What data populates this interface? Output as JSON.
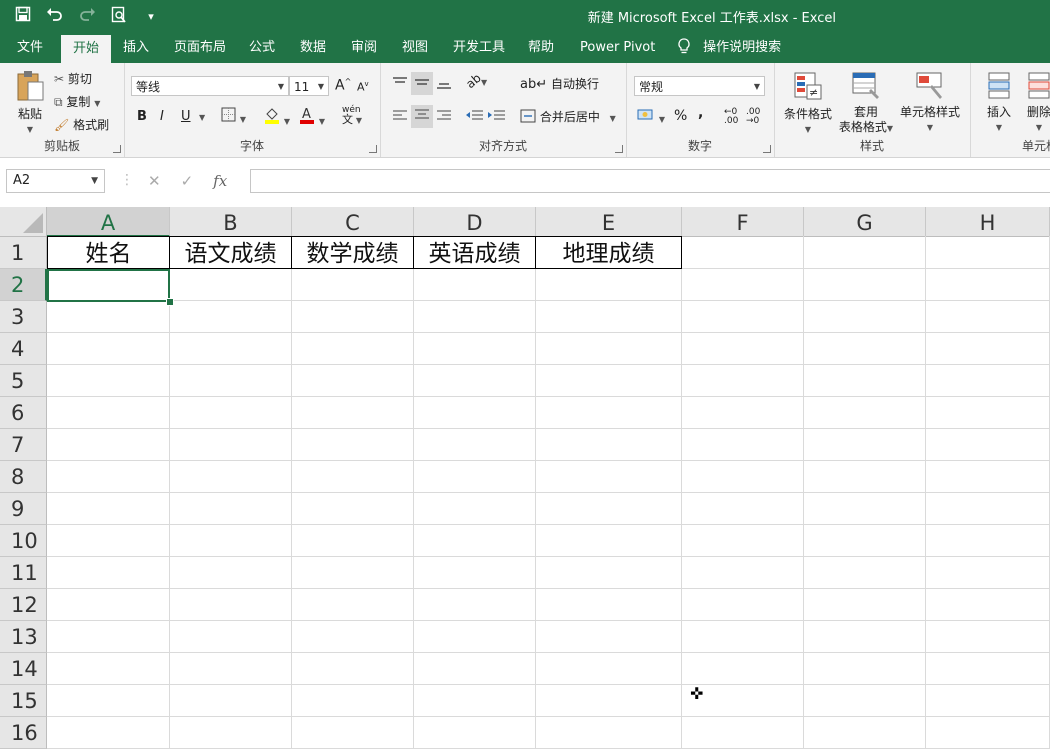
{
  "window": {
    "title": "新建 Microsoft Excel 工作表.xlsx  -  Excel"
  },
  "qat": {
    "save": "save-icon",
    "undo": "undo-icon",
    "redo": "redo-icon",
    "print_preview": "print-preview-icon",
    "customize": "▾"
  },
  "menu": {
    "tabs": [
      "文件",
      "开始",
      "插入",
      "页面布局",
      "公式",
      "数据",
      "审阅",
      "视图",
      "开发工具",
      "帮助",
      "Power Pivot"
    ],
    "active_tab": "开始",
    "tell_me": "操作说明搜索"
  },
  "ribbon": {
    "clipboard": {
      "label": "剪贴板",
      "paste": "粘贴",
      "cut": "剪切",
      "copy": "复制",
      "format_painter": "格式刷"
    },
    "font": {
      "label": "字体",
      "name": "等线",
      "size": "11",
      "bold": "B",
      "italic": "I",
      "underline": "U",
      "phonetic": "wén"
    },
    "alignment": {
      "label": "对齐方式",
      "wrap_text": "自动换行",
      "merge_center": "合并后居中"
    },
    "number": {
      "label": "数字",
      "format": "常规",
      "percent": "%",
      "comma": ","
    },
    "styles": {
      "label": "样式",
      "conditional": "条件格式",
      "table_fmt_1": "套用",
      "table_fmt_2": "表格格式",
      "cell_styles": "单元格样式"
    },
    "cells": {
      "label": "单元格",
      "insert": "插入",
      "delete": "删除"
    }
  },
  "formula_bar": {
    "name_box": "A2",
    "cancel": "✕",
    "enter": "✓",
    "fx": "fx",
    "formula": ""
  },
  "sheet": {
    "columns": [
      "A",
      "B",
      "C",
      "D",
      "E",
      "F",
      "G",
      "H"
    ],
    "rows": [
      "1",
      "2",
      "3",
      "4",
      "5",
      "6",
      "7",
      "8",
      "9",
      "10",
      "11",
      "12",
      "13",
      "14",
      "15",
      "16"
    ],
    "header_row": [
      "姓名",
      "语文成绩",
      "数学成绩",
      "英语成绩",
      "地理成绩"
    ],
    "active_cell": "A2"
  },
  "colors": {
    "accent": "#217346",
    "ribbon_bg": "#f3f3f3",
    "header_bg": "#e6e6e6"
  }
}
